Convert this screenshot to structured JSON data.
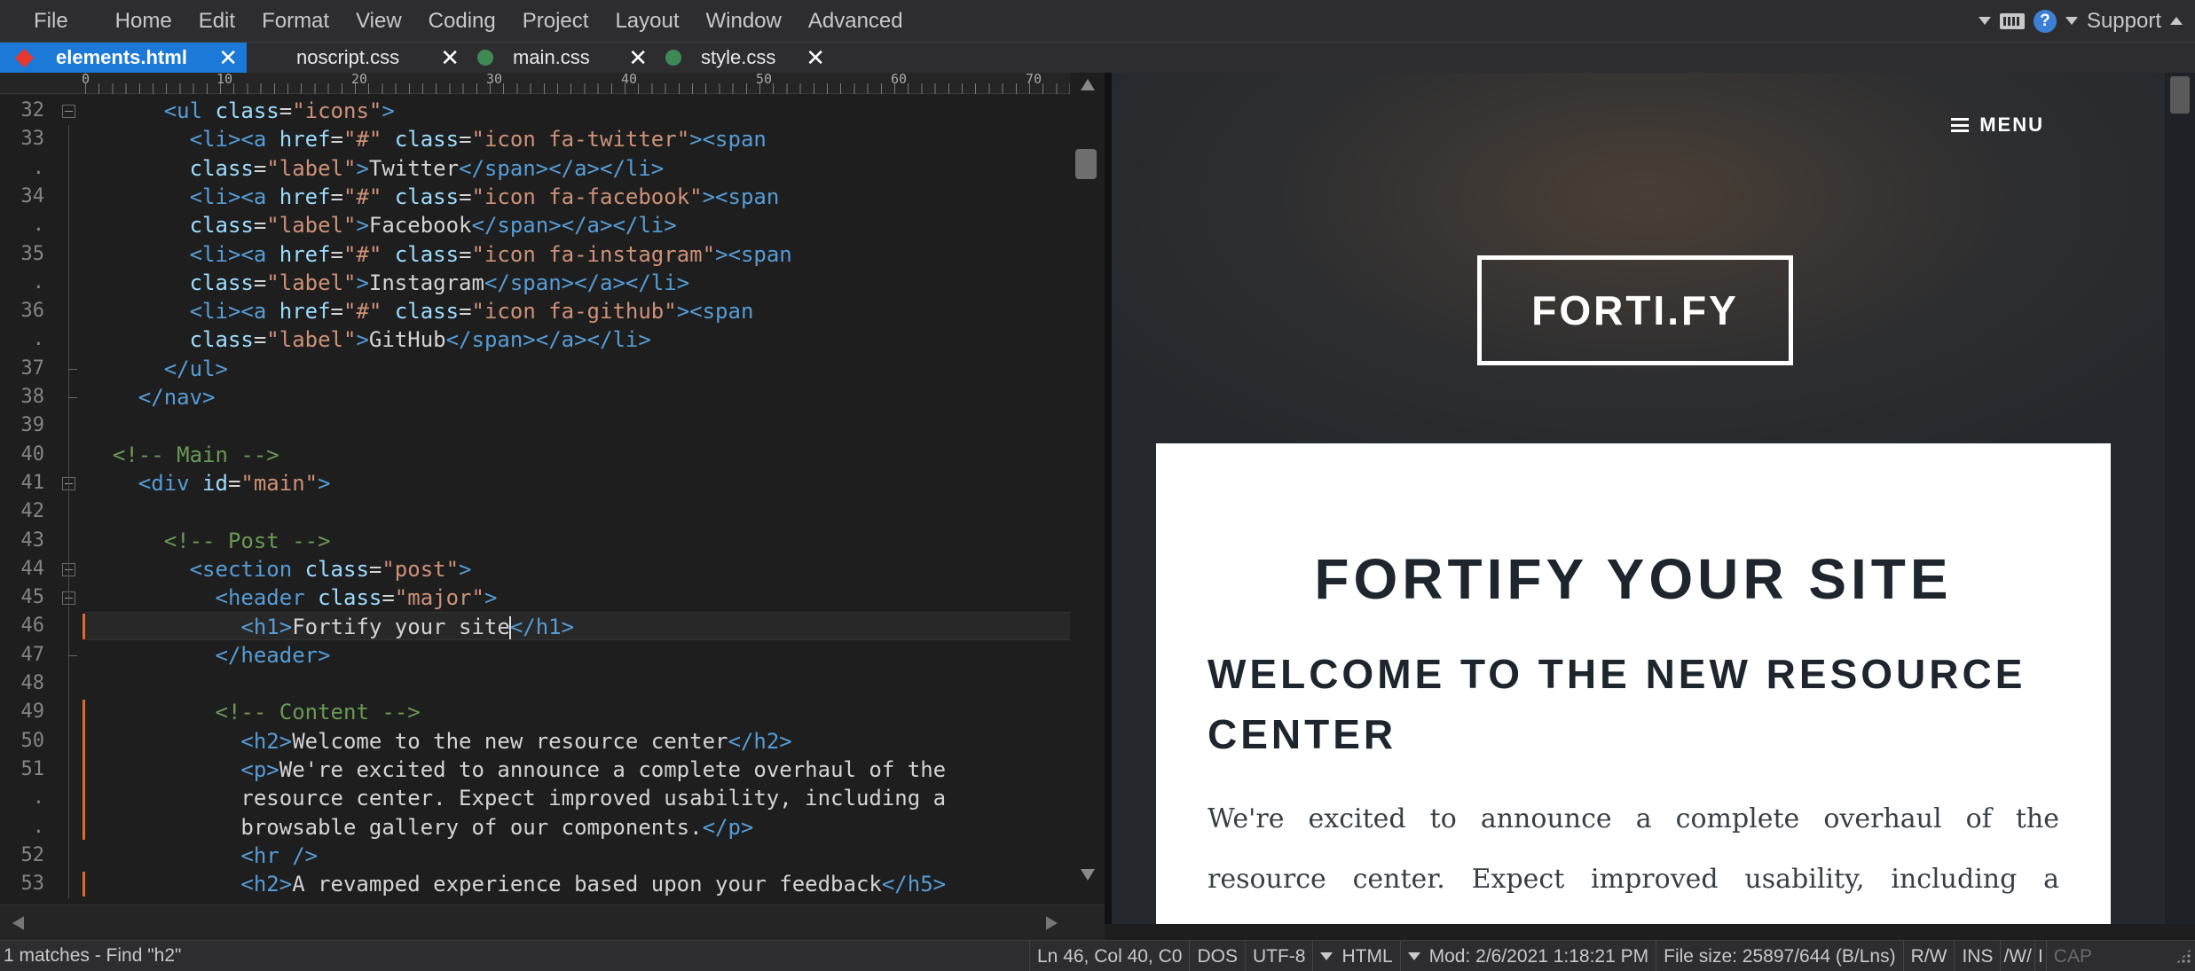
{
  "menubar": {
    "items": [
      "File",
      "Home",
      "Edit",
      "Format",
      "View",
      "Coding",
      "Project",
      "Layout",
      "Window",
      "Advanced"
    ],
    "support_label": "Support"
  },
  "tabs": [
    {
      "label": "elements.html",
      "active": true,
      "marker": "diamond",
      "color": "#e8382d"
    },
    {
      "label": "noscript.css",
      "active": false,
      "marker": "none",
      "color": ""
    },
    {
      "label": "main.css",
      "active": false,
      "marker": "dot",
      "color": "#3f8a54"
    },
    {
      "label": "style.css",
      "active": false,
      "marker": "dot",
      "color": "#3f8a54"
    }
  ],
  "ruler": {
    "labels": [
      "0",
      "10",
      "20",
      "30",
      "40",
      "50",
      "60",
      "70"
    ]
  },
  "gutter": {
    "numbers": [
      "32",
      "33",
      ".",
      "34",
      ".",
      "35",
      ".",
      "36",
      ".",
      "37",
      "38",
      "39",
      "40",
      "41",
      "42",
      "43",
      "44",
      "45",
      "46",
      "47",
      "48",
      "49",
      "50",
      "51",
      ".",
      ".",
      "52",
      "53"
    ]
  },
  "code": {
    "lines": [
      [
        [
          "      ",
          "tx"
        ],
        [
          "<ul ",
          "t"
        ],
        [
          "class",
          "a"
        ],
        [
          "=",
          "tx"
        ],
        [
          "\"icons\"",
          "s"
        ],
        [
          ">",
          "t"
        ]
      ],
      [
        [
          "        ",
          "tx"
        ],
        [
          "<li><a ",
          "t"
        ],
        [
          "href",
          "a"
        ],
        [
          "=",
          "tx"
        ],
        [
          "\"#\"",
          "s"
        ],
        [
          " ",
          "tx"
        ],
        [
          "class",
          "a"
        ],
        [
          "=",
          "tx"
        ],
        [
          "\"icon fa-twitter\"",
          "s"
        ],
        [
          "><span",
          "t"
        ]
      ],
      [
        [
          "        ",
          "tx"
        ],
        [
          "class",
          "a"
        ],
        [
          "=",
          "tx"
        ],
        [
          "\"label\"",
          "s"
        ],
        [
          ">",
          "t"
        ],
        [
          "Twitter",
          "tx"
        ],
        [
          "</span></a></li>",
          "t"
        ]
      ],
      [
        [
          "        ",
          "tx"
        ],
        [
          "<li><a ",
          "t"
        ],
        [
          "href",
          "a"
        ],
        [
          "=",
          "tx"
        ],
        [
          "\"#\"",
          "s"
        ],
        [
          " ",
          "tx"
        ],
        [
          "class",
          "a"
        ],
        [
          "=",
          "tx"
        ],
        [
          "\"icon fa-facebook\"",
          "s"
        ],
        [
          "><span",
          "t"
        ]
      ],
      [
        [
          "        ",
          "tx"
        ],
        [
          "class",
          "a"
        ],
        [
          "=",
          "tx"
        ],
        [
          "\"label\"",
          "s"
        ],
        [
          ">",
          "t"
        ],
        [
          "Facebook",
          "tx"
        ],
        [
          "</span></a></li>",
          "t"
        ]
      ],
      [
        [
          "        ",
          "tx"
        ],
        [
          "<li><a ",
          "t"
        ],
        [
          "href",
          "a"
        ],
        [
          "=",
          "tx"
        ],
        [
          "\"#\"",
          "s"
        ],
        [
          " ",
          "tx"
        ],
        [
          "class",
          "a"
        ],
        [
          "=",
          "tx"
        ],
        [
          "\"icon fa-instagram\"",
          "s"
        ],
        [
          "><span",
          "t"
        ]
      ],
      [
        [
          "        ",
          "tx"
        ],
        [
          "class",
          "a"
        ],
        [
          "=",
          "tx"
        ],
        [
          "\"label\"",
          "s"
        ],
        [
          ">",
          "t"
        ],
        [
          "Instagram",
          "tx"
        ],
        [
          "</span></a></li>",
          "t"
        ]
      ],
      [
        [
          "        ",
          "tx"
        ],
        [
          "<li><a ",
          "t"
        ],
        [
          "href",
          "a"
        ],
        [
          "=",
          "tx"
        ],
        [
          "\"#\"",
          "s"
        ],
        [
          " ",
          "tx"
        ],
        [
          "class",
          "a"
        ],
        [
          "=",
          "tx"
        ],
        [
          "\"icon fa-github\"",
          "s"
        ],
        [
          "><span",
          "t"
        ]
      ],
      [
        [
          "        ",
          "tx"
        ],
        [
          "class",
          "a"
        ],
        [
          "=",
          "tx"
        ],
        [
          "\"label\"",
          "s"
        ],
        [
          ">",
          "t"
        ],
        [
          "GitHub",
          "tx"
        ],
        [
          "</span></a></li>",
          "t"
        ]
      ],
      [
        [
          "      ",
          "tx"
        ],
        [
          "</ul>",
          "t"
        ]
      ],
      [
        [
          "    ",
          "tx"
        ],
        [
          "</nav>",
          "t"
        ]
      ],
      [
        [
          "",
          "tx"
        ]
      ],
      [
        [
          "  ",
          "tx"
        ],
        [
          "<!-- Main -->",
          "c"
        ]
      ],
      [
        [
          "    ",
          "tx"
        ],
        [
          "<div ",
          "t"
        ],
        [
          "id",
          "a"
        ],
        [
          "=",
          "tx"
        ],
        [
          "\"main\"",
          "s"
        ],
        [
          ">",
          "t"
        ]
      ],
      [
        [
          "",
          "tx"
        ]
      ],
      [
        [
          "      ",
          "tx"
        ],
        [
          "<!-- Post -->",
          "c"
        ]
      ],
      [
        [
          "        ",
          "tx"
        ],
        [
          "<section ",
          "t"
        ],
        [
          "class",
          "a"
        ],
        [
          "=",
          "tx"
        ],
        [
          "\"post\"",
          "s"
        ],
        [
          ">",
          "t"
        ]
      ],
      [
        [
          "          ",
          "tx"
        ],
        [
          "<header ",
          "t"
        ],
        [
          "class",
          "a"
        ],
        [
          "=",
          "tx"
        ],
        [
          "\"major\"",
          "s"
        ],
        [
          ">",
          "t"
        ]
      ],
      [
        [
          "            ",
          "tx"
        ],
        [
          "<h1>",
          "t"
        ],
        [
          "Fortify your site",
          "tx"
        ],
        [
          "|CARET|",
          "caret"
        ],
        [
          "</h1>",
          "t"
        ]
      ],
      [
        [
          "          ",
          "tx"
        ],
        [
          "</header>",
          "t"
        ]
      ],
      [
        [
          "",
          "tx"
        ]
      ],
      [
        [
          "          ",
          "tx"
        ],
        [
          "<!-- Content -->",
          "c"
        ]
      ],
      [
        [
          "            ",
          "tx"
        ],
        [
          "<h2>",
          "t"
        ],
        [
          "Welcome to the new resource center",
          "tx"
        ],
        [
          "</h2>",
          "t"
        ]
      ],
      [
        [
          "            ",
          "tx"
        ],
        [
          "<p>",
          "t"
        ],
        [
          "We're excited to announce a complete overhaul of the",
          "tx"
        ]
      ],
      [
        [
          "            ",
          "tx"
        ],
        [
          "resource center. Expect improved usability, including a",
          "tx"
        ]
      ],
      [
        [
          "            ",
          "tx"
        ],
        [
          "browsable gallery of our components.",
          "tx"
        ],
        [
          "</p>",
          "t"
        ]
      ],
      [
        [
          "            ",
          "tx"
        ],
        [
          "<hr />",
          "t"
        ]
      ],
      [
        [
          "            ",
          "tx"
        ],
        [
          "<h2>",
          "t"
        ],
        [
          "A revamped experience based upon your feedback",
          "tx"
        ],
        [
          "</h5>",
          "t"
        ]
      ]
    ]
  },
  "preview": {
    "menu_label": "MENU",
    "logo_text": "FORTI.FY",
    "h1": "FORTIFY YOUR SITE",
    "h2": "WELCOME TO THE NEW RESOURCE CENTER",
    "paragraph": "We're excited to announce a complete overhaul of the resource center. Expect improved usability, including a browsable gallery of"
  },
  "status": {
    "find": "1 matches - Find \"h2\"",
    "position": "Ln 46, Col 40, C0",
    "line_endings": "DOS",
    "encoding": "UTF-8",
    "language": "HTML",
    "modified": "Mod: 2/6/2021 1:18:21 PM",
    "file_size": "File size: 25897/644 (B/Lns)",
    "mode_rw": "R/W",
    "mode_ins": "INS",
    "mode_w": "/W/",
    "mode_i": "I",
    "mode_cap": "CAP"
  }
}
